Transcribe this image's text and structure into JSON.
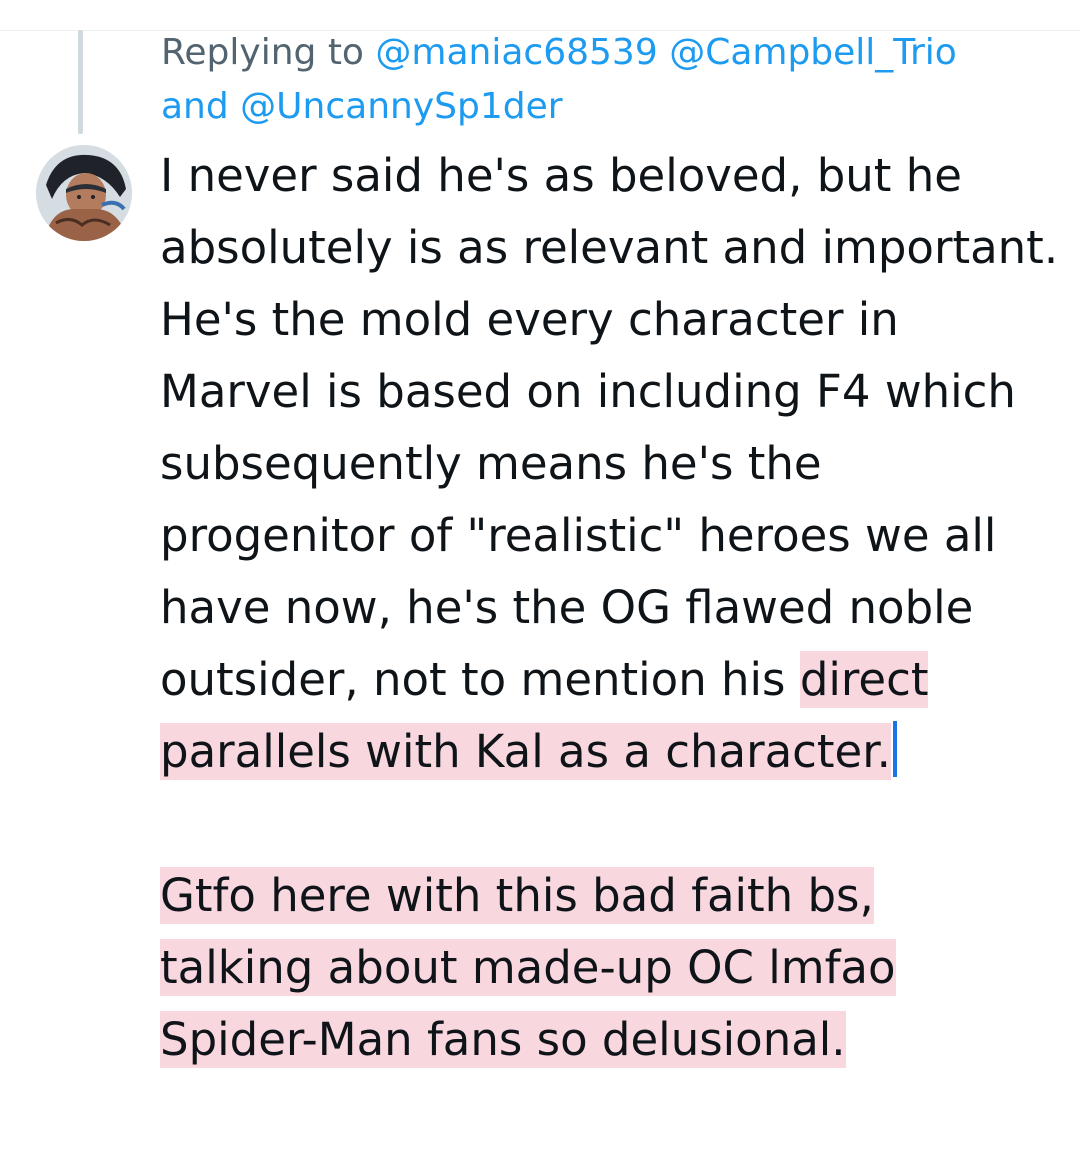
{
  "reply_context": {
    "prefix": "Replying to ",
    "mentions": [
      "@maniac68539",
      "@Campbell_Trio",
      "@UncannySp1der"
    ],
    "conjunction": "and "
  },
  "avatar": {
    "icon": "comic-character-avatar"
  },
  "tweet": {
    "paragraph1_plain": "I never said he's as beloved, but he absolutely is as relevant and important. He's the mold every character in Marvel is based on including F4 which subsequently means he's the progenitor of \"realistic\" heroes we all have now, he's the OG flawed noble outsider, not to mention his",
    "paragraph1_highlight": "direct parallels with Kal as a character.",
    "paragraph2_highlight_lines": [
      "Gtfo here with this bad faith bs,",
      "talking about made-up OC lmfao",
      "Spider-Man fans so delusional."
    ]
  },
  "colors": {
    "text": "#0f1419",
    "muted": "#536471",
    "link": "#1d9bf0",
    "highlight": "#f9d7df",
    "caret": "#1a73e8"
  }
}
